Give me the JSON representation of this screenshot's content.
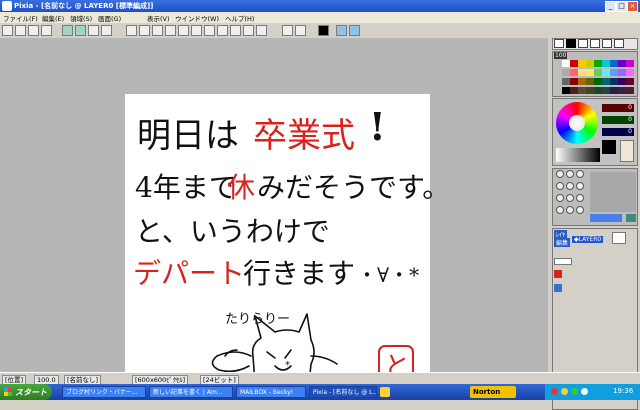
{
  "window": {
    "title": "Pixia - [名前なし @ LAYER0 [標準編成]]"
  },
  "menu": [
    "ファイル(F)",
    "編集(E)",
    "領域(S)",
    "画面(G)",
    "表示(V)",
    "ウインドウ(W)",
    "ヘルプ(H)"
  ],
  "canvas_text": {
    "line1_black": "明日は",
    "line1_red": "卒業式",
    "line1_mark": "!",
    "line2a": "4年まで",
    "line2_red": "休",
    "line2b": "みだそうです。",
    "line3": "と、いうわけで",
    "line4_red": "デパート",
    "line4b": "行きます",
    "line4c": "・∀・*",
    "doodle_caption": "たりらりー",
    "stamp": "と"
  },
  "right_panel": {
    "brush_size": "100",
    "color_r": "0",
    "color_g": "0",
    "color_b": "0",
    "layer_label": "◆LAYER0",
    "tab_layer": "ﾚｲﾔ",
    "tab_edit": "編集"
  },
  "status": {
    "zoom": "100.0",
    "name": "[名前なし]",
    "size": "[600x600ﾋﾟｸｾﾙ]",
    "bits": "[24ビット]",
    "mode": "[位置]"
  },
  "taskbar": {
    "start": "スタート",
    "tasks": [
      "ブログ村リンク・バナー...",
      "新しい記事を書く | Am...",
      "MAILBOX - Becky!",
      "Pixia - [名前なし @ L..."
    ],
    "norton": "Norton",
    "clock": "19:36"
  },
  "colors": {
    "red": "#d6231f",
    "ink": "#111111",
    "titlebar": "#2456d1"
  }
}
